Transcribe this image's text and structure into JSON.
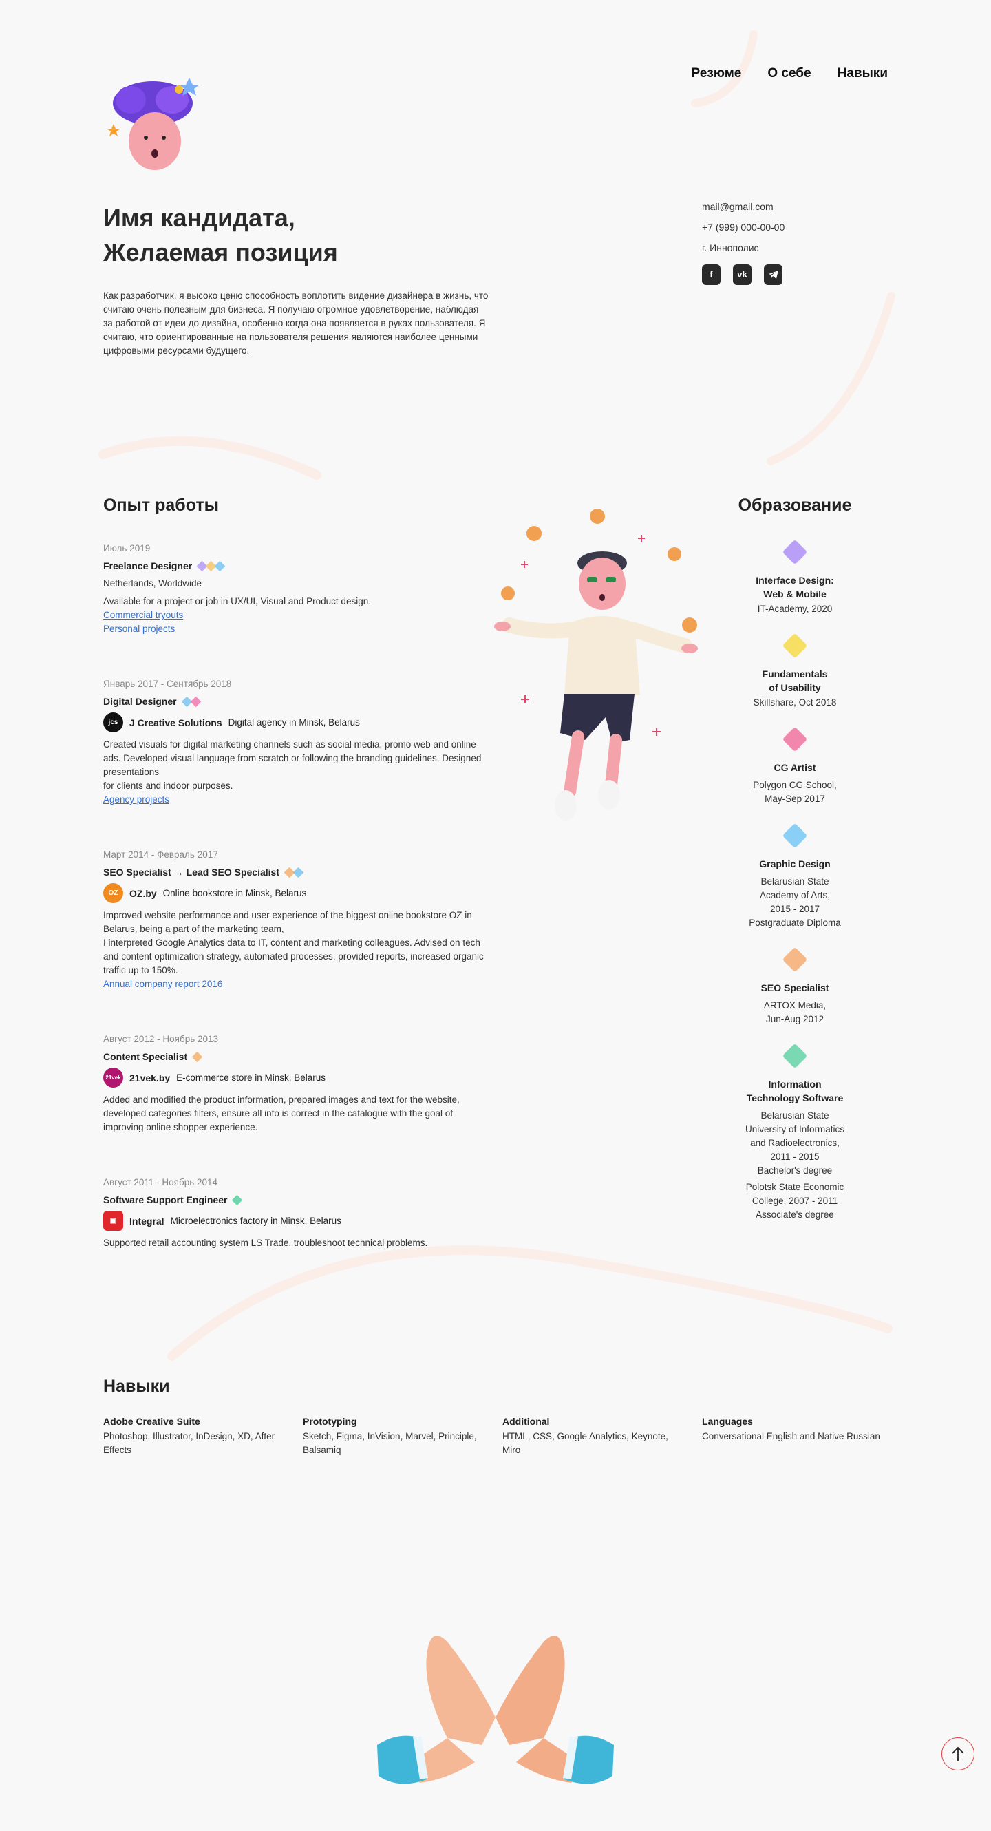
{
  "nav": {
    "items": [
      "Резюме",
      "О себе",
      "Навыки"
    ]
  },
  "hero": {
    "title_line1": "Имя кандидата,",
    "title_line2": "Желаемая позиция",
    "description": "Как разработчик, я высоко ценю способность воплотить видение дизайнера в жизнь, что считаю очень полезным для бизнеса. Я получаю огромное удовлетворение, наблюдая за работой от идеи до дизайна, особенно когда она появляется в руках пользователя. Я считаю, что ориентированные на пользователя решения являются наиболее ценными цифровыми ресурсами будущего."
  },
  "contacts": {
    "email": "mail@gmail.com",
    "phone": "+7 (999) 000-00-00",
    "city": "г. Иннополис",
    "socials": [
      "facebook-icon",
      "vk-icon",
      "telegram-icon"
    ]
  },
  "experience": {
    "title": "Опыт работы",
    "jobs": [
      {
        "date": "Июль 2019",
        "role": "Freelance Designer",
        "gem_colors": [
          "#b59cf5",
          "#f5c86a",
          "#7ac6f0"
        ],
        "location": "Netherlands, Worldwide",
        "desc": "Available for a project or job in UX/UI, Visual and Product design.",
        "link1": "Commercial tryouts",
        "link2": "Personal projects"
      },
      {
        "date": "Январь 2017 - Сентябрь 2018",
        "role": "Digital Designer",
        "gem_colors": [
          "#7ac6f0",
          "#f07ab0"
        ],
        "logo_text": "jcs",
        "logo_color": "#111",
        "company": "J Creative Solutions",
        "company_desc": "Digital agency in Minsk, Belarus",
        "desc1": "Created visuals for digital marketing channels such as social media, promo web and online ads. Developed visual language from scratch or following the branding guidelines. Designed presentations",
        "desc2": "for clients and indoor purposes.",
        "link1": "Agency projects"
      },
      {
        "date": "Март 2014 - Февраль 2017",
        "role": "SEO Specialist → Lead SEO Specialist",
        "gem_colors": [
          "#f5b070",
          "#7ac6f0"
        ],
        "logo_text": "OZ",
        "logo_color": "#f08a1e",
        "company": "OZ.by",
        "company_desc": "Online bookstore in Minsk, Belarus",
        "desc1": "Improved website performance and user experience of the biggest online bookstore OZ in Belarus, being a part of the marketing team,",
        "desc2": "I interpreted Google Analytics data to IT, content and marketing colleagues. Advised on tech and content optimization strategy, automated processes, provided reports, increased organic traffic up to 150%.",
        "link1": "Annual company report 2016"
      },
      {
        "date": "Август 2012 - Ноябрь 2013",
        "role": "Content Specialist",
        "gem_colors": [
          "#f5b070"
        ],
        "logo_text": "21vek",
        "logo_color": "#b0166e",
        "company": "21vek.by",
        "company_desc": "E-commerce store in Minsk, Belarus",
        "desc1": "Added and modified the product information, prepared images and text for the website, developed categories filters, ensure all info is correct in the catalogue with the goal of improving online shopper experience."
      },
      {
        "date": "Август 2011 - Ноябрь 2014",
        "role": "Software Support Engineer",
        "gem_colors": [
          "#5ad0a0"
        ],
        "logo_text": "▣",
        "logo_color": "#e0262b",
        "company": "Integral",
        "company_desc": "Microelectronics factory in Minsk, Belarus",
        "desc1": "Supported retail accounting system LS Trade, troubleshoot technical problems."
      }
    ]
  },
  "education": {
    "title": "Образование",
    "items": [
      {
        "gem": "#a98af5",
        "title1": "Interface Design:",
        "title2": "Web & Mobile",
        "lines": [
          "IT-Academy, 2020"
        ]
      },
      {
        "gem": "#f5d83c",
        "title1": "Fundamentals",
        "title2": "of Usability",
        "lines": [
          "Skillshare, Oct 2018"
        ]
      },
      {
        "gem": "#f06a9a",
        "title1": "CG Artist",
        "title2": "",
        "lines": [
          "Polygon CG School,",
          "May-Sep 2017"
        ]
      },
      {
        "gem": "#6ec4f5",
        "title1": "Graphic Design",
        "title2": "",
        "lines": [
          "Belarusian State",
          "Academy of Arts,",
          "2015 - 2017",
          "Postgraduate Diploma"
        ]
      },
      {
        "gem": "#f5a86a",
        "title1": "SEO Specialist",
        "title2": "",
        "lines": [
          "ARTOX Media,",
          "Jun-Aug 2012"
        ]
      },
      {
        "gem": "#5ad0a0",
        "title1": "Information",
        "title2": "Technology Software",
        "lines": [
          "Belarusian State",
          "University of Informatics",
          "and Radioelectronics,",
          "2011 - 2015",
          "Bachelor's degree"
        ],
        "lines2": [
          "Polotsk State Economic",
          "College, 2007 - 2011",
          "Associate's degree"
        ]
      }
    ]
  },
  "skills": {
    "title": "Навыки",
    "groups": [
      {
        "title": "Adobe Creative Suite",
        "value": "Photoshop, Illustrator, InDesign, XD, After Effects"
      },
      {
        "title": "Prototyping",
        "value": "Sketch, Figma, InVision, Marvel, Principle, Balsamiq"
      },
      {
        "title": "Additional",
        "value": "HTML, CSS, Google Analytics, Keynote, Miro"
      },
      {
        "title": "Languages",
        "value": "Conversational English and Native Russian"
      }
    ]
  },
  "colors": {
    "accent_link": "#2f6fd6",
    "up_button": "#dd4444",
    "deco_arc": "#fbeee8"
  }
}
